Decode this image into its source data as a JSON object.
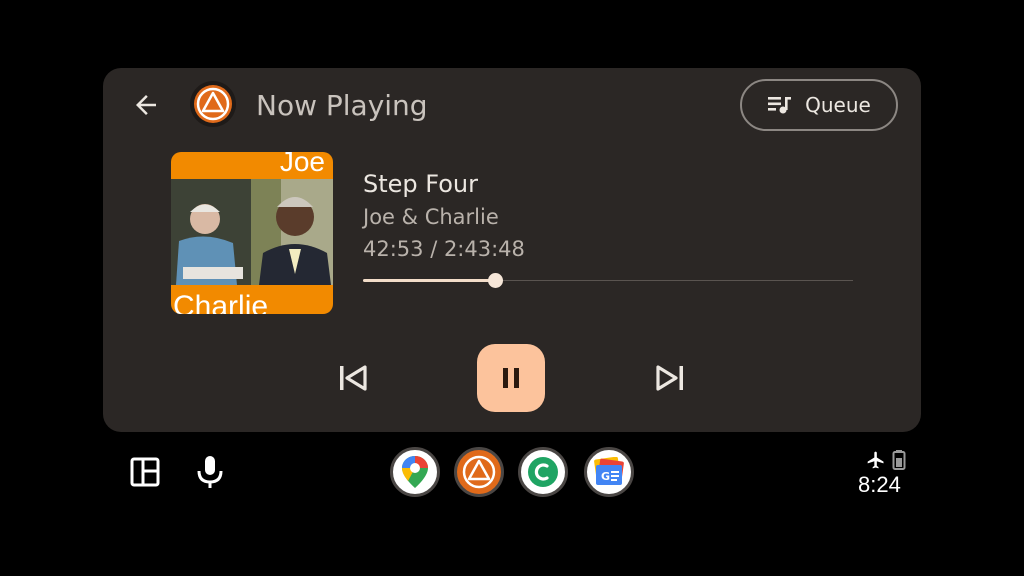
{
  "header": {
    "title": "Now Playing",
    "queue_label": "Queue"
  },
  "album_art": {
    "text_top": "Joe",
    "text_bottom": "Charlie",
    "accent": "#f28a00"
  },
  "track": {
    "title": "Step Four",
    "artist": "Joe & Charlie",
    "time_readout": "42:53 / 2:43:48",
    "progress_fraction": 0.27
  },
  "controls": {
    "prev_icon": "skip-previous-icon",
    "play_icon": "pause-icon",
    "next_icon": "skip-next-icon"
  },
  "dock": {
    "left_icons": [
      "dashboard-icon",
      "microphone-icon"
    ],
    "apps": [
      "google-maps",
      "podcast-app",
      "chat-app",
      "google-news"
    ]
  },
  "status": {
    "time": "8:24",
    "icons": [
      "airplane-icon",
      "battery-icon"
    ]
  },
  "colors": {
    "card_bg": "#2b2725",
    "play_button": "#fcc39c",
    "background": "#000000"
  }
}
